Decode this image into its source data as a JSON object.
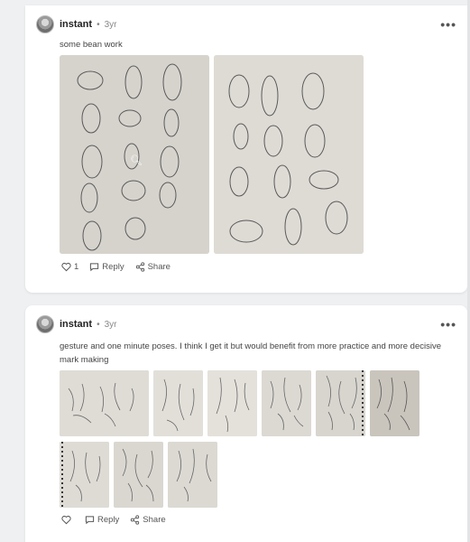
{
  "posts": [
    {
      "username": "instant",
      "separator": "•",
      "age": "3yr",
      "text": "some bean work",
      "likes": "1",
      "reply_label": "Reply",
      "share_label": "Share"
    },
    {
      "username": "instant",
      "separator": "•",
      "age": "3yr",
      "text": "gesture and one minute poses. I think I get it but would benefit from more practice and more decisive mark making",
      "likes": "",
      "reply_label": "Reply",
      "share_label": "Share"
    }
  ],
  "icons": {
    "more": "more-horizontal-icon",
    "zoom": "zoom-icon",
    "like": "heart-icon",
    "reply": "comment-icon",
    "share": "share-icon"
  },
  "colors": {
    "page_bg": "#eef0f2",
    "card_bg": "#ffffff",
    "paper": "#d9d6d0",
    "pencil": "#555555"
  }
}
